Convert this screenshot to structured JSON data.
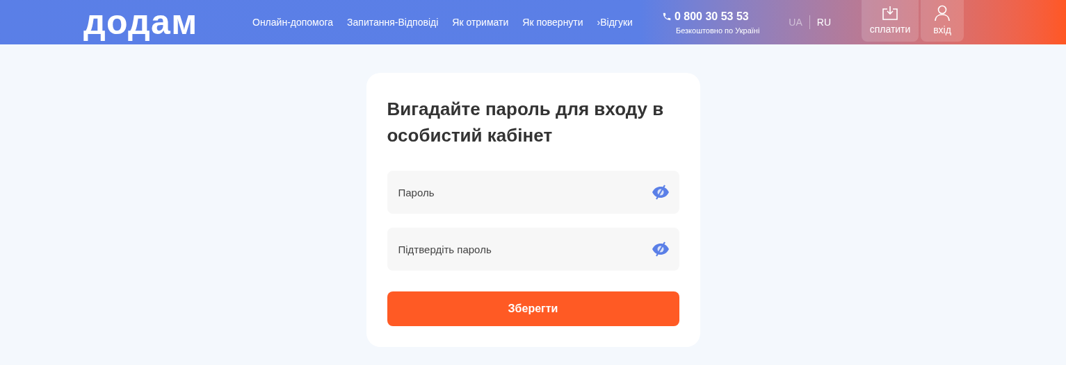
{
  "header": {
    "logo": "додам",
    "nav": [
      "Онлайн-допомога",
      "Запитання-Відповіді",
      "Як отримати",
      "Як повернути",
      "›Відгуки"
    ],
    "phone": {
      "number": "0 800 30 53 53",
      "note": "Безкоштовно по Україні"
    },
    "languages": [
      {
        "label": "UA",
        "selected": true
      },
      {
        "label": "RU",
        "selected": false
      }
    ],
    "actions": [
      {
        "kind": "pay",
        "label": "сплатити"
      },
      {
        "kind": "login",
        "label": "вхід"
      }
    ]
  },
  "form": {
    "title": "Вигадайте пароль для входу в особистий кабінет",
    "fields": [
      {
        "placeholder": "Пароль"
      },
      {
        "placeholder": "Підтвердіть пароль"
      }
    ],
    "submit": "Зберегти"
  }
}
